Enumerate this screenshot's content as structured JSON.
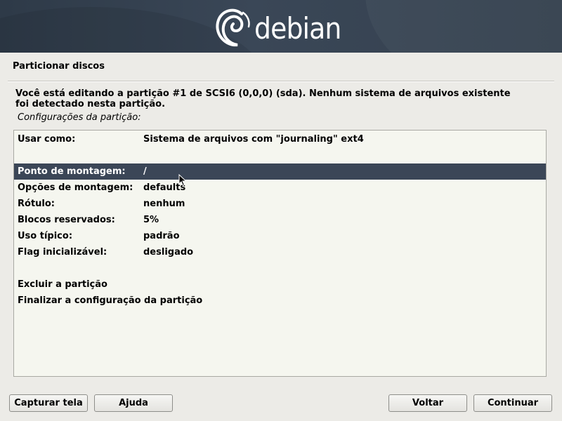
{
  "header": {
    "logo_text": "debian",
    "brand_colors": {
      "banner": "#36424f",
      "selection": "#3b4657",
      "list_bg": "#f5f6ef",
      "window_bg": "#ecebe7"
    }
  },
  "page": {
    "title": "Particionar discos",
    "intro": "Você está editando a partição #1 de SCSI6 (0,0,0) (sda). Nenhum sistema de arquivos existente foi detectado nesta partição.",
    "section_label": "Configurações da partição:"
  },
  "settings": [
    {
      "key": "Usar como:",
      "value": "Sistema de arquivos com \"journaling\" ext4"
    },
    {
      "key": "Ponto de montagem:",
      "value": "/",
      "selected": true
    },
    {
      "key": "Opções de montagem:",
      "value": "defaults"
    },
    {
      "key": "Rótulo:",
      "value": "nenhum"
    },
    {
      "key": "Blocos reservados:",
      "value": "5%"
    },
    {
      "key": "Uso típico:",
      "value": "padrão"
    },
    {
      "key": "Flag inicializável:",
      "value": "desligado"
    }
  ],
  "actions": [
    {
      "label": "Excluir a partição"
    },
    {
      "label": "Finalizar a configuração da partição"
    }
  ],
  "buttons": {
    "screenshot": "Capturar tela",
    "help": "Ajuda",
    "back": "Voltar",
    "continue": "Continuar"
  },
  "icons": {
    "logo": "debian-swirl-icon",
    "pointer": "mouse-pointer-icon"
  }
}
